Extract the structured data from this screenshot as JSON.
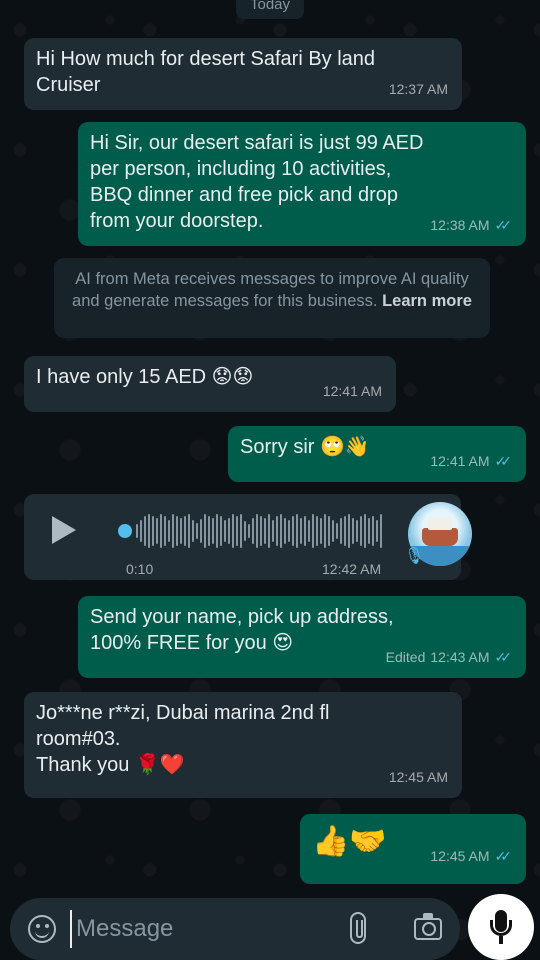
{
  "date_chip": "Today",
  "messages": [
    {
      "id": "m1",
      "text": "Hi How much for desert Safari By land\nCruiser",
      "time": "12:37 AM"
    },
    {
      "id": "m2",
      "text": "Hi Sir, our desert safari is just 99 AED\nper person, including 10 activities,\nBBQ dinner and free pick and drop\nfrom your doorstep.",
      "time": "12:38 AM"
    },
    {
      "id": "m3",
      "text": "I have only 15 AED 😟😟",
      "time": "12:41 AM"
    },
    {
      "id": "m4",
      "text": "Sorry sir 🙄👋",
      "time": "12:41 AM"
    },
    {
      "id": "m6",
      "text": "Send your name, pick up address,\n100% FREE for you 😍",
      "time": "12:43 AM",
      "edited_label": "Edited"
    },
    {
      "id": "m7",
      "text": "Jo***ne r**zi, Dubai marina 2nd fl\nroom#03.\nThank you 🌹❤️",
      "time": "12:45 AM"
    },
    {
      "id": "m8",
      "text": "👍🤝",
      "time": "12:45 AM"
    }
  ],
  "notice": {
    "text": "AI from Meta receives messages to improve AI quality and generate messages for this business. ",
    "link": "Learn more"
  },
  "voice_message": {
    "duration": "0:10",
    "time": "12:42 AM",
    "progress": 0
  },
  "composer": {
    "placeholder": "Message"
  },
  "colors": {
    "incoming_bubble": "#202c33",
    "outgoing_bubble": "#005c4b",
    "read_ticks": "#53bdeb"
  },
  "icons": [
    "sticker-icon",
    "attach-icon",
    "camera-icon",
    "mic-icon",
    "play-icon",
    "double-check-icon"
  ]
}
